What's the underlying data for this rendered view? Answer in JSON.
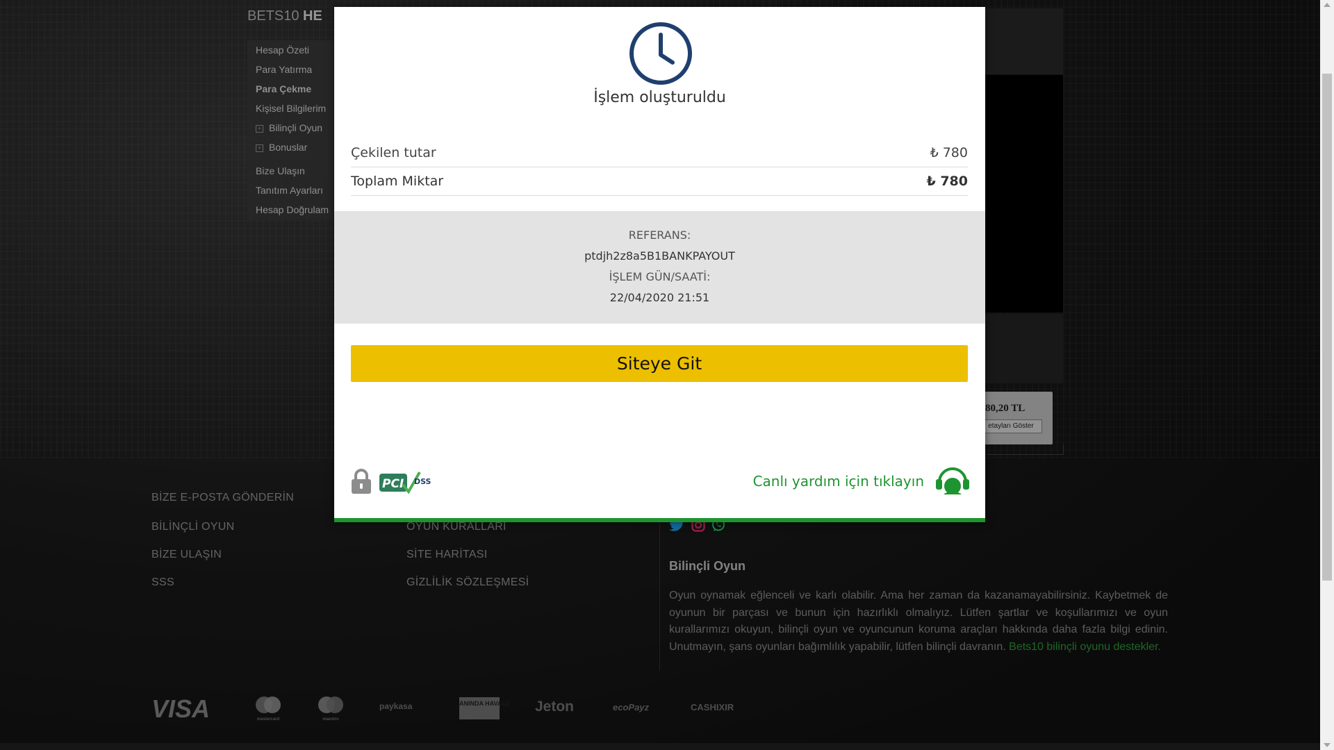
{
  "background": {
    "brand": {
      "prefix": "BETS10",
      "bold": "HE"
    },
    "menu_items": [
      {
        "label": "Hesap Özeti",
        "bold": false,
        "plus": false
      },
      {
        "label": "Para Yatırma",
        "bold": false,
        "plus": false
      },
      {
        "label": "Para Çekme",
        "bold": true,
        "plus": false
      },
      {
        "label": "Kişisel Bilgilerim",
        "bold": false,
        "plus": false
      },
      {
        "label": "Bilinçli Oyun",
        "bold": false,
        "plus": true
      },
      {
        "label": "Bonuslar",
        "bold": false,
        "plus": true
      },
      {
        "label": "Bize Ulaşın",
        "bold": false,
        "plus": false
      },
      {
        "label": "Tanıtım Ayarları",
        "bold": false,
        "plus": false
      },
      {
        "label": "Hesap Doğrulam",
        "bold": false,
        "plus": false
      }
    ],
    "balance_amount": "80,20 TL",
    "balance_button": "etayları Göster"
  },
  "footer": {
    "left_links": [
      "BİZE E-POSTA GÖNDERİN",
      "BİLİNÇLİ OYUN",
      "BİZE ULAŞIN",
      "SSS"
    ],
    "mid_links": [
      "OYUN KURALLARI",
      "SİTE HARİTASI",
      "GİZLİLİK SÖZLEŞMESİ"
    ],
    "bilincli_title": "Bilinçli Oyun",
    "bilincli_text": "Oyun oynamak eğlenceli ve karlı olabilir. Ama her zaman da kazanamayabilirsiniz. Kaybetmek de oyunun bir parçası ve bunun için hazırlıklı olmalıyız. Lütfen şartlar ve koşullarımızı ve oyun kurallarımızı okuyun, bilinçli oyun ve oyuncunun koruma araçları hakkında daha fazla bilgi edinin. Unutmayın, şans oyunları bağımlılık yapabilir, lütfen bilinçli davranın.",
    "bilincli_link": "Bets10 bilinçli oyunu destekler.",
    "payment_logos": [
      "VISA",
      "mastercard",
      "maestro",
      "paykasa",
      "ANINDA HAVALE",
      "Jeton",
      "ecoPayz",
      "CASHIXIR"
    ]
  },
  "modal": {
    "title": "İşlem oluşturuldu",
    "rows": [
      {
        "label": "Çekilen tutar",
        "amount": "₺ 780"
      },
      {
        "label": "Toplam Miktar",
        "amount": "₺ 780"
      }
    ],
    "reference_label": "REFERANS:",
    "reference_value": "ptdjh2z8a5B1BANKPAYOUT",
    "datetime_label": "İŞLEM GÜN/SAATİ:",
    "datetime_value": "22/04/2020 21:51",
    "site_button": "Siteye Git",
    "pci_text": "PCI",
    "dss_text": "DSS",
    "help_link": "Canlı yardım için tıklayın",
    "colors": {
      "accent_green": "#1e9430",
      "button_yellow": "#ecbf00",
      "icon_navy": "#1f3f6e"
    }
  }
}
